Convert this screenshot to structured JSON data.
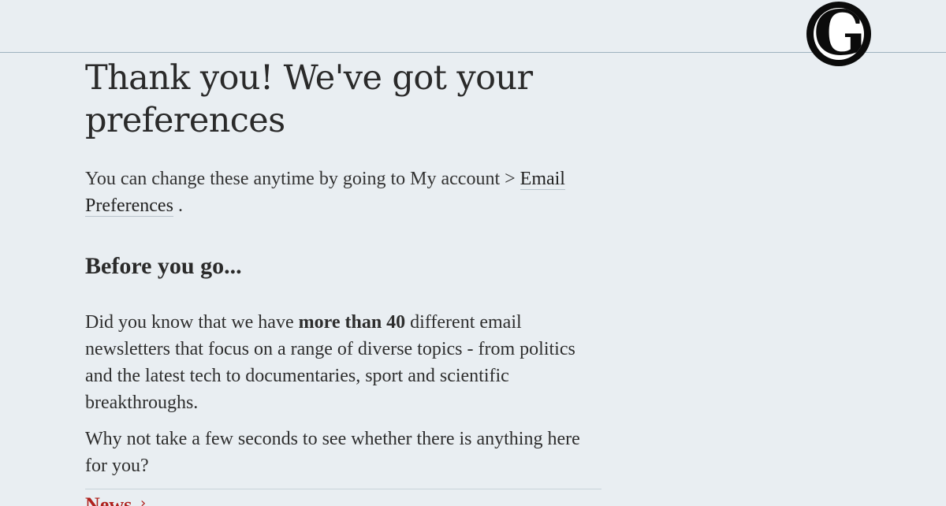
{
  "logo": {
    "letter": "G",
    "alt": "guardian-logo"
  },
  "headline": "Thank you! We've got your preferences",
  "intro": {
    "text_before": "You can change these anytime by going to My account > ",
    "link_label": "Email Preferences",
    "text_after": " ."
  },
  "section": {
    "heading": "Before you go...",
    "para1_before": "Did you know that we have ",
    "para1_bold": "more than 40",
    "para1_after": " different email newsletters that focus on a range of diverse topics - from politics and the latest tech to documentaries, sport and scientific breakthroughs.",
    "para2": "Why not take a few seconds to see whether there is anything here for you?"
  },
  "category": {
    "label": "News",
    "arrow": "›"
  },
  "colors": {
    "background": "#e9eef2",
    "text": "#222222",
    "accent_red": "#b0221e",
    "rule": "#9fb2bf"
  }
}
